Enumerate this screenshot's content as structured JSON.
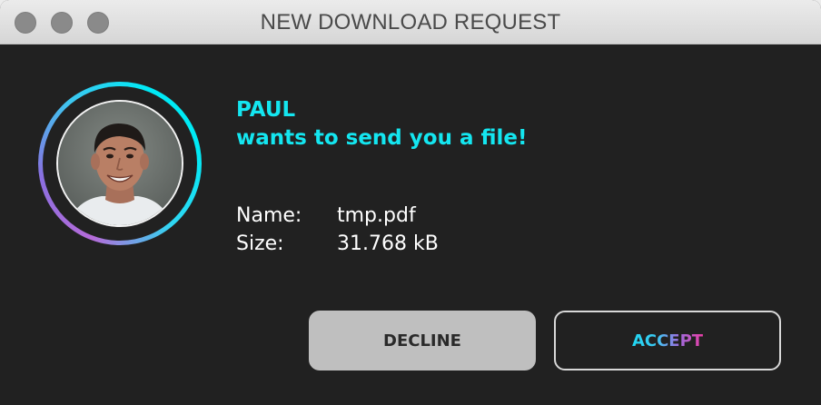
{
  "window": {
    "title": "NEW DOWNLOAD REQUEST"
  },
  "request": {
    "sender": "PAUL",
    "message": "wants to send you a file!"
  },
  "file": {
    "name_label": "Name:",
    "name_value": "tmp.pdf",
    "size_label": "Size:",
    "size_value": "31.768 kB"
  },
  "actions": {
    "decline_label": "DECLINE",
    "accept_label": "ACCEPT"
  },
  "colors": {
    "accent_cyan": "#14e6f0",
    "accent_pink": "#e83da6",
    "background": "#212121"
  }
}
